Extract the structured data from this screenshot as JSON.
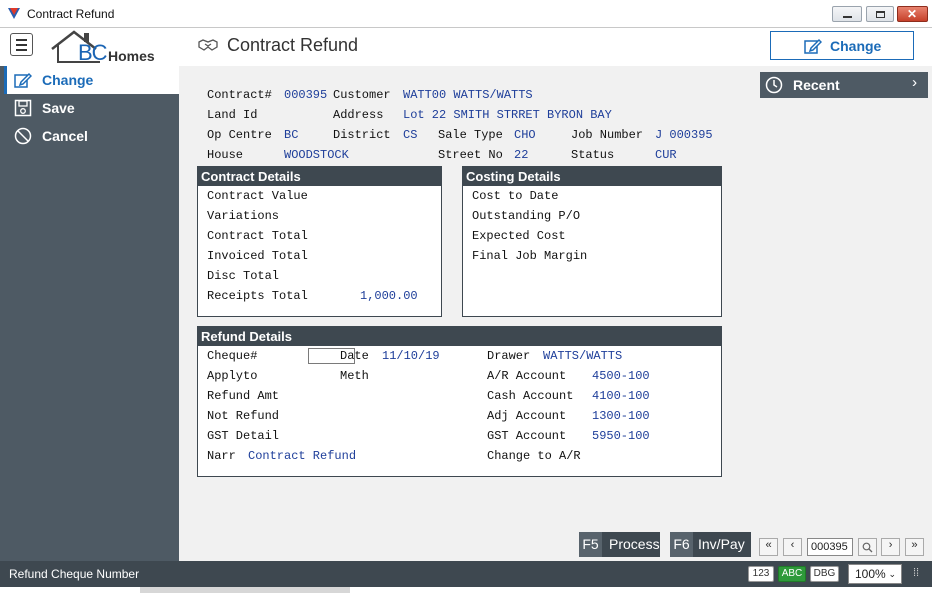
{
  "window": {
    "title": "Contract Refund"
  },
  "header": {
    "logo_bc": "BC",
    "logo_homes": "Homes",
    "page_title": "Contract Refund",
    "change_label": "Change",
    "accent": "#1b6bb8"
  },
  "sidebar": {
    "items": [
      {
        "label": "Change",
        "icon": "edit-icon"
      },
      {
        "label": "Save",
        "icon": "save-icon"
      },
      {
        "label": "Cancel",
        "icon": "cancel-icon"
      }
    ]
  },
  "recent": {
    "label": "Recent"
  },
  "contract": {
    "contract_label": "Contract#",
    "contract_value": "000395",
    "customer_label": "Customer",
    "customer_value": "WATT00 WATTS/WATTS",
    "landid_label": "Land Id",
    "address_label": "Address",
    "address_value": "Lot 22 SMITH STRRET BYRON BAY",
    "opcentre_label": "Op Centre",
    "opcentre_value": "BC",
    "district_label": "District",
    "district_value": "CS",
    "saletype_label": "Sale Type",
    "saletype_value": "CHO",
    "jobnumber_label": "Job Number",
    "jobnumber_value": "J 000395",
    "house_label": "House",
    "house_value": "WOODSTOCK",
    "streetno_label": "Street No",
    "streetno_value": "22",
    "status_label": "Status",
    "status_value": "CUR"
  },
  "contract_details": {
    "title": "Contract Details",
    "rows": [
      {
        "label": "Contract Value",
        "value": ""
      },
      {
        "label": "Variations",
        "value": ""
      },
      {
        "label": "Contract Total",
        "value": ""
      },
      {
        "label": "Invoiced Total",
        "value": ""
      },
      {
        "label": "Disc Total",
        "value": ""
      },
      {
        "label": "Receipts Total",
        "value": "1,000.00"
      }
    ]
  },
  "costing_details": {
    "title": "Costing Details",
    "rows": [
      {
        "label": "Cost to Date"
      },
      {
        "label": "Outstanding P/O"
      },
      {
        "label": "Expected Cost"
      },
      {
        "label": "Final Job Margin"
      }
    ]
  },
  "refund_details": {
    "title": "Refund Details",
    "cheque_label": "Cheque#",
    "cheque_value": "",
    "date_label": "Date",
    "date_value": "11/10/19",
    "drawer_label": "Drawer",
    "drawer_value": "WATTS/WATTS",
    "applyto_label": "Applyto",
    "meth_label": "Meth",
    "ar_label": "A/R  Account",
    "ar_value": "4500-100",
    "refundamt_label": "Refund Amt",
    "cash_label": "Cash Account",
    "cash_value": "4100-100",
    "notrefund_label": "Not Refund",
    "adj_label": "Adj  Account",
    "adj_value": "1300-100",
    "gstdetail_label": "GST Detail",
    "gst_label": "GST  Account",
    "gst_value": "5950-100",
    "narr_label": "Narr",
    "narr_value": "Contract Refund",
    "changeto_label": "Change to A/R"
  },
  "actions": {
    "process_key": "F5",
    "process_label": "Process",
    "invpay_key": "F6",
    "invpay_label": "Inv/Pay"
  },
  "record_nav": {
    "current": "000395"
  },
  "statusbar": {
    "message": "Refund Cheque Number",
    "badge_123": "123",
    "badge_abc": "ABC",
    "badge_dbg": "DBG",
    "zoom": "100%"
  }
}
